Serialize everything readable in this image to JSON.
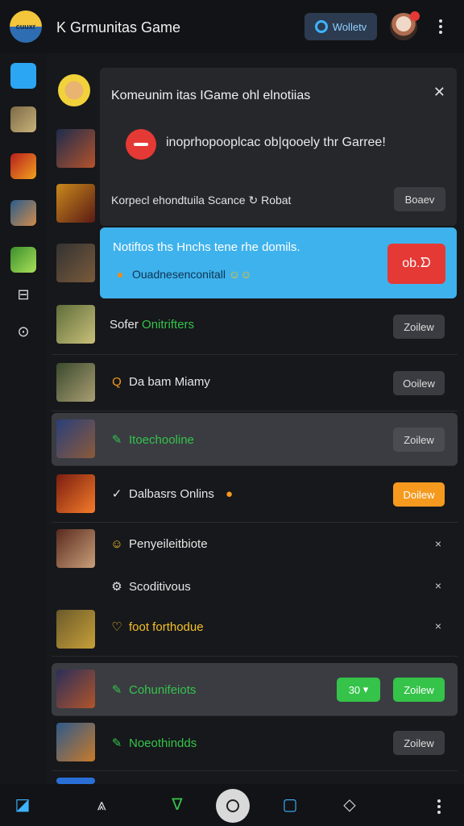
{
  "app": {
    "logo_text": "cuuxr",
    "title": "K Grmunitas Game",
    "wallet_label": "Wolletv"
  },
  "colors": {
    "accent_blue": "#3eb2ec",
    "green": "#35c34a",
    "orange": "#f59a1f",
    "red": "#e53935"
  },
  "banner": {
    "title": "Komeunim itas IGame ohl elnotiias",
    "message": "inoprhopooplcac ob|qooely thr Garree!",
    "footer": "Korpecl ehondtuila Scance",
    "footer_tail": "Robat",
    "action": "Boaev"
  },
  "promo": {
    "title": "Notiftos ths Hnchs tene rhe domils.",
    "subtitle": "Ouadnesenconitall",
    "action": "ob.ᗤ"
  },
  "rows": [
    {
      "label": "Sofer",
      "label_suffix": "Onitrifters",
      "action": "Zoilew"
    },
    {
      "label": "Da bam Miamy",
      "action": "Ooilew"
    },
    {
      "label": "Itoechooline",
      "action": "Zoilew"
    },
    {
      "label": "Dalbasrs Onlins",
      "action": "Doilew"
    },
    {
      "label": "Penyeileitbiote",
      "action": "×"
    },
    {
      "label": "Scoditivous",
      "action": "×"
    },
    {
      "label": "foot forthodue",
      "action": "×"
    },
    {
      "label": "Cohunifeiots",
      "pill": "30",
      "action": "Zoilew"
    },
    {
      "label": "Noeothindds",
      "action": "Zoilew"
    }
  ]
}
